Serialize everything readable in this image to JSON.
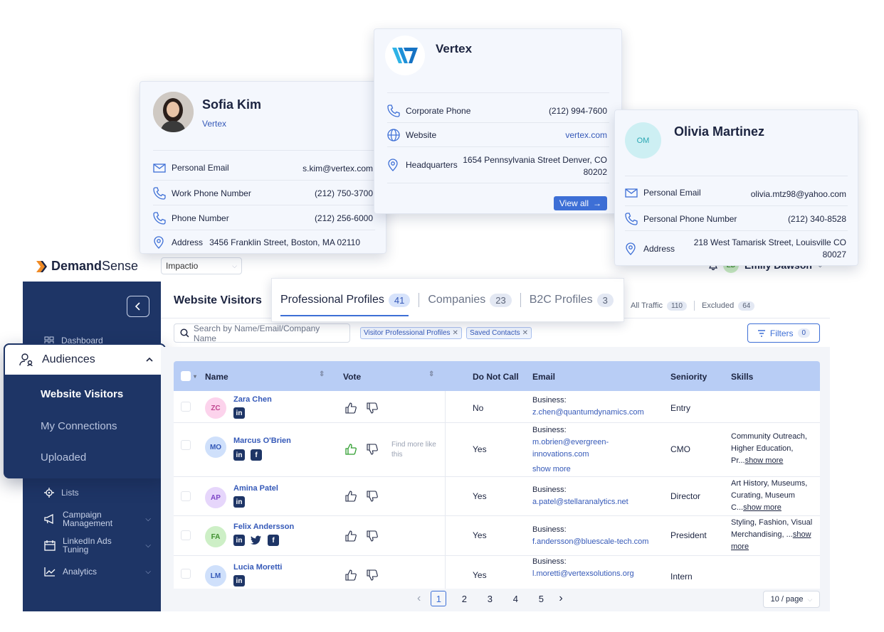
{
  "brand": {
    "bold": "Demand",
    "rest": "Sense"
  },
  "workspace": {
    "value": "Impactio"
  },
  "user": {
    "initials": "ED",
    "name": "Emily Dawson"
  },
  "sidebar": {
    "dashboard": "Dashboard",
    "audiences": "Audiences",
    "audience_items": [
      "Website Visitors",
      "My Connections",
      "Uploaded"
    ],
    "lists": "Lists",
    "campaign_line1": "Campaign",
    "campaign_line2": "Management",
    "linkedin_line1": "LinkedIn Ads",
    "linkedin_line2": "Tuning",
    "analytics": "Analytics"
  },
  "main": {
    "title": "Website Visitors",
    "tabs": [
      {
        "label": "Professional Profiles",
        "count": "41"
      },
      {
        "label": "Companies",
        "count": "23"
      },
      {
        "label": "B2C Profiles",
        "count": "3"
      }
    ],
    "traffic": {
      "all_label": "All Traffic",
      "all_count": "110",
      "excluded_label": "Excluded",
      "excluded_count": "64"
    },
    "search_placeholder": "Search by Name/Email/Company Name",
    "chips": [
      "Visitor Professional Profiles",
      "Saved Contacts"
    ],
    "filters": {
      "label": "Filters",
      "count": "0"
    }
  },
  "table": {
    "headers": {
      "name": "Name",
      "vote": "Vote",
      "dnc": "Do Not Call",
      "email": "Email",
      "seniority": "Seniority",
      "skills": "Skills"
    },
    "rows": [
      {
        "initials": "ZC",
        "name": "Zara Chen",
        "dnc": "No",
        "email_type": "Business:",
        "email": "z.chen@quantumdynamics.com",
        "seniority": "Entry"
      },
      {
        "initials": "MO",
        "name": "Marcus O'Brien",
        "find_more": "Find more like this",
        "dnc": "Yes",
        "email_type": "Business:",
        "email_l1": "m.obrien@evergreen-",
        "email_l2": "innovations.com",
        "email_more": "show more",
        "seniority": "CMO",
        "skills_l1": "Community Outreach,",
        "skills_l2": "Higher Education,",
        "skills_l3": "Pr...",
        "skills_more": "show more"
      },
      {
        "initials": "AP",
        "name": "Amina Patel",
        "dnc": "Yes",
        "email_type": "Business:",
        "email": "a.patel@stellaranalytics.net",
        "seniority": "Director",
        "skills_l1": "Art History, Museums,",
        "skills_l2": "Curating, Museum",
        "skills_l3": "C...",
        "skills_more": "show more"
      },
      {
        "initials": "FA",
        "name": "Felix Andersson",
        "dnc": "Yes",
        "email_type": "Business:",
        "email": "f.andersson@bluescale-tech.com",
        "seniority": "President",
        "skills_l1": "Styling, Fashion, Visual",
        "skills_l2": "Merchandising, ...",
        "skills_more1": "show",
        "skills_more2": "more"
      },
      {
        "initials": "LM",
        "name": "Lucia Moretti",
        "dnc": "Yes",
        "email_type": "Business:",
        "email": "l.moretti@vertexsolutions.org",
        "seniority": "Intern"
      }
    ]
  },
  "pagination": {
    "pages": [
      "1",
      "2",
      "3",
      "4",
      "5"
    ],
    "per_page": "10 / page"
  },
  "cards": {
    "sofia": {
      "name": "Sofia Kim",
      "company": "Vertex",
      "fields": [
        {
          "label": "Personal Email",
          "value": "s.kim@vertex.com"
        },
        {
          "label": "Work Phone Number",
          "value": "(212) 750-3700"
        },
        {
          "label": "Phone Number",
          "value": "(212) 256-6000"
        },
        {
          "label": "Address",
          "value": "3456 Franklin Street, Boston, MA 02110"
        }
      ]
    },
    "vertex": {
      "name": "Vertex",
      "fields": [
        {
          "label": "Corporate Phone",
          "value": "(212) 994-7600"
        },
        {
          "label": "Website",
          "value": "vertex.com"
        },
        {
          "label": "Headquarters",
          "value_l1": "1654 Pennsylvania Street Denver, CO",
          "value_l2": "80202"
        }
      ],
      "view_all": "View all"
    },
    "olivia": {
      "initials": "OM",
      "name": "Olivia Martinez",
      "fields": [
        {
          "label": "Personal Email",
          "value": "olivia.mtz98@yahoo.com"
        },
        {
          "label": "Personal Phone Number",
          "value": "(212) 340-8528"
        },
        {
          "label": "Address",
          "value_l1": "218 West Tamarisk Street, Louisville CO",
          "value_l2": "80027"
        }
      ]
    }
  },
  "colors": {
    "sidebar": "#1e3566",
    "accent": "#3d6fd6",
    "table_header": "#b8cdf5",
    "link": "#3559b8"
  }
}
